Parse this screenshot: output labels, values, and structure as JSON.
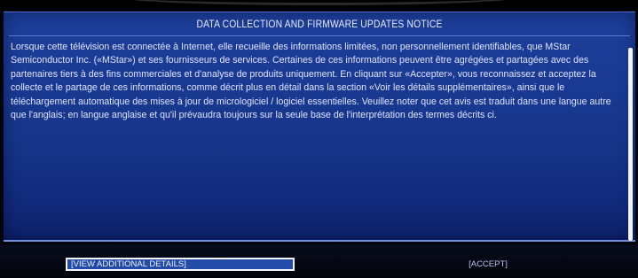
{
  "dialog": {
    "title": "DATA COLLECTION AND FIRMWARE UPDATES NOTICE",
    "body": "Lorsque cette télévision est connectée à Internet, elle recueille des informations limitées, non personnellement identifiables, que MStar Semiconductor Inc. («MStar») et ses fournisseurs de services. Certaines de ces informations peuvent être agrégées et partagées avec des partenaires tiers à des fins commerciales et d'analyse de produits uniquement. En cliquant sur «Accepter», vous reconnaissez et acceptez la collecte et le partage de ces informations, comme décrit plus en détail dans la section «Voir les détails supplémentaires», ainsi que le téléchargement automatique des mises à jour de micrologiciel / logiciel essentielles. Veuillez noter que cet avis est traduit dans une langue autre que l'anglais; en langue anglaise et qu'il prévaudra toujours sur la seule base de l'interprétation des termes décrits ci."
  },
  "buttons": {
    "details": "[VIEW ADDITIONAL DETAILS]",
    "accept": "[ACCEPT]"
  },
  "colors": {
    "dialog_blue": "#1a3a93",
    "focus_border": "#f3f5ff"
  }
}
